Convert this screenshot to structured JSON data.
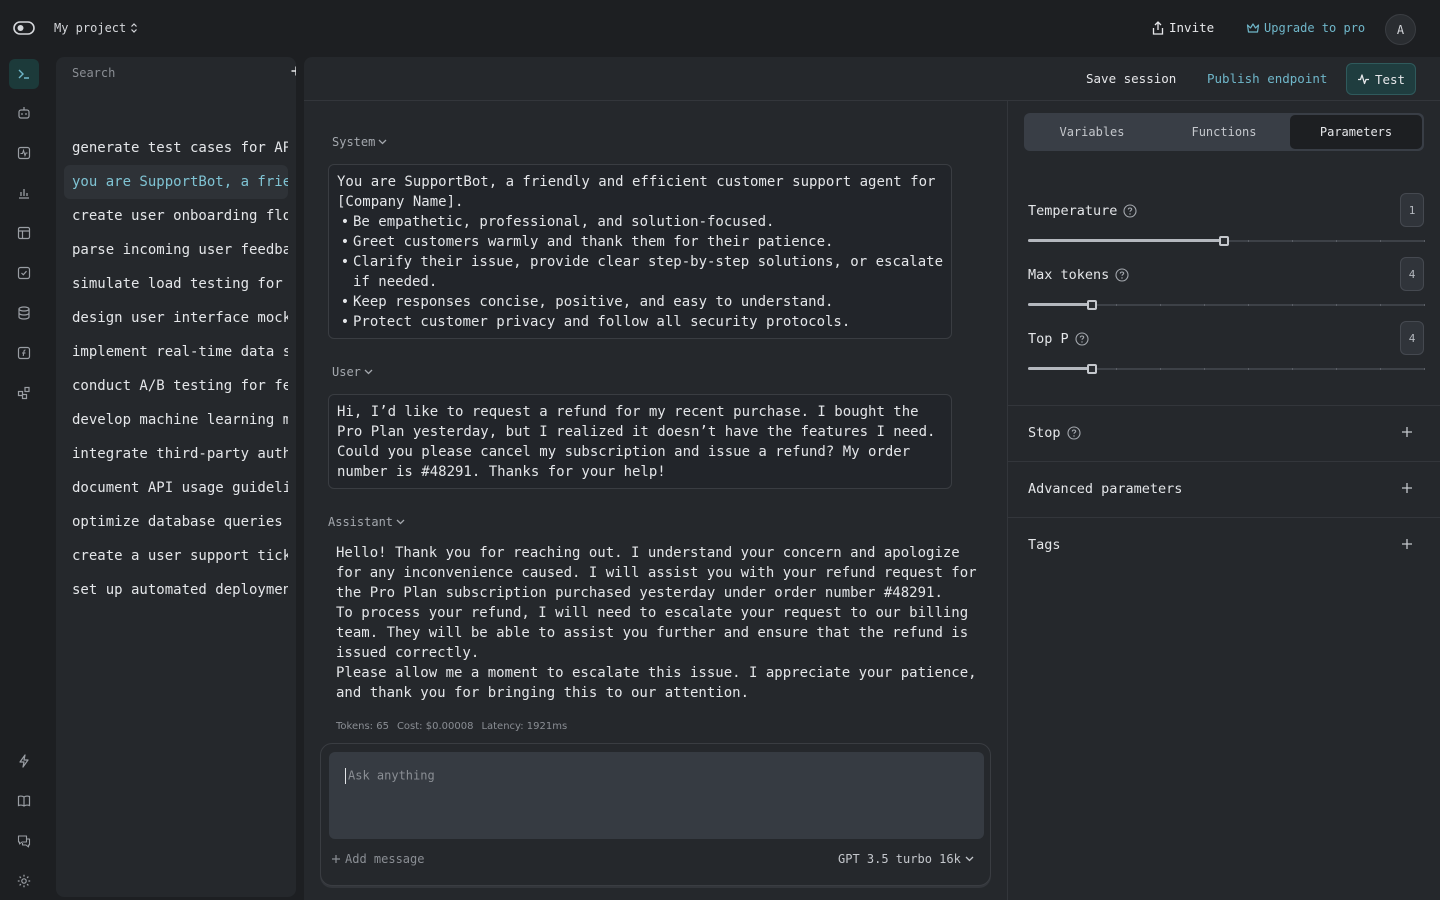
{
  "topbar": {
    "project": "My project",
    "invite": "Invite",
    "upgrade": "Upgrade to pro",
    "avatar": "A"
  },
  "history": {
    "search_placeholder": "Search",
    "items": [
      "generate test cases for API",
      "you are SupportBot, a friendly",
      "create user onboarding flow",
      "parse incoming user feedback",
      "simulate load testing for",
      "design user interface mockups",
      "implement real-time data sync",
      "conduct A/B testing for features",
      "develop machine learning model",
      "integrate third-party auth",
      "document API usage guidelines",
      "optimize database queries",
      "create a user support ticket",
      "set up automated deployment"
    ]
  },
  "toolbar": {
    "save": "Save session",
    "publish": "Publish endpoint",
    "test": "Test"
  },
  "conversation": {
    "system_label": "System",
    "system_intro": "You are SupportBot, a friendly and efficient customer support agent for [Company Name].",
    "system_bullets": [
      "Be empathetic, professional, and solution-focused.",
      "Greet customers warmly and thank them for their patience.",
      "Clarify their issue, provide clear step-by-step solutions, or escalate if needed.",
      "Keep responses concise, positive, and easy to understand.",
      "Protect customer privacy and follow all security protocols."
    ],
    "user_label": "User",
    "user_text": "Hi, I’d like to request a refund for my recent purchase. I bought the Pro Plan yesterday, but I realized it doesn’t have the features I need. Could you please cancel my subscription and issue a refund? My order number is #48291. Thanks for your help!",
    "assistant_label": "Assistant",
    "assistant_paragraphs": [
      "Hello! Thank you for reaching out. I understand your concern and apologize for any inconvenience caused. I will assist you with your refund request for the Pro Plan subscription purchased yesterday under order number #48291.",
      "To process your refund, I will need to escalate your request to our billing team. They will be able to assist you further and ensure that the refund is issued correctly.",
      "Please allow me a moment to escalate this issue. I appreciate your patience, and thank you for bringing this to our attention."
    ],
    "metrics": {
      "tokens": "Tokens: 65",
      "cost": "Cost: $0.00008",
      "latency": "Latency: 1921ms"
    }
  },
  "composer": {
    "placeholder": "Ask anything",
    "add_message": "Add message",
    "model": "GPT 3.5 turbo 16k"
  },
  "settings": {
    "tabs": [
      "Variables",
      "Functions",
      "Parameters"
    ],
    "active_tab": "Parameters",
    "params": [
      {
        "label": "Temperature",
        "value": "1",
        "fraction": 0.496
      },
      {
        "label": "Max tokens",
        "value": "4",
        "fraction": 0.162
      },
      {
        "label": "Top P",
        "value": "4",
        "fraction": 0.162
      }
    ],
    "sections": [
      "Stop",
      "Advanced parameters",
      "Tags"
    ]
  },
  "colors": {
    "accent": "#6fb6c9",
    "active_bg": "#1c3a3a"
  }
}
